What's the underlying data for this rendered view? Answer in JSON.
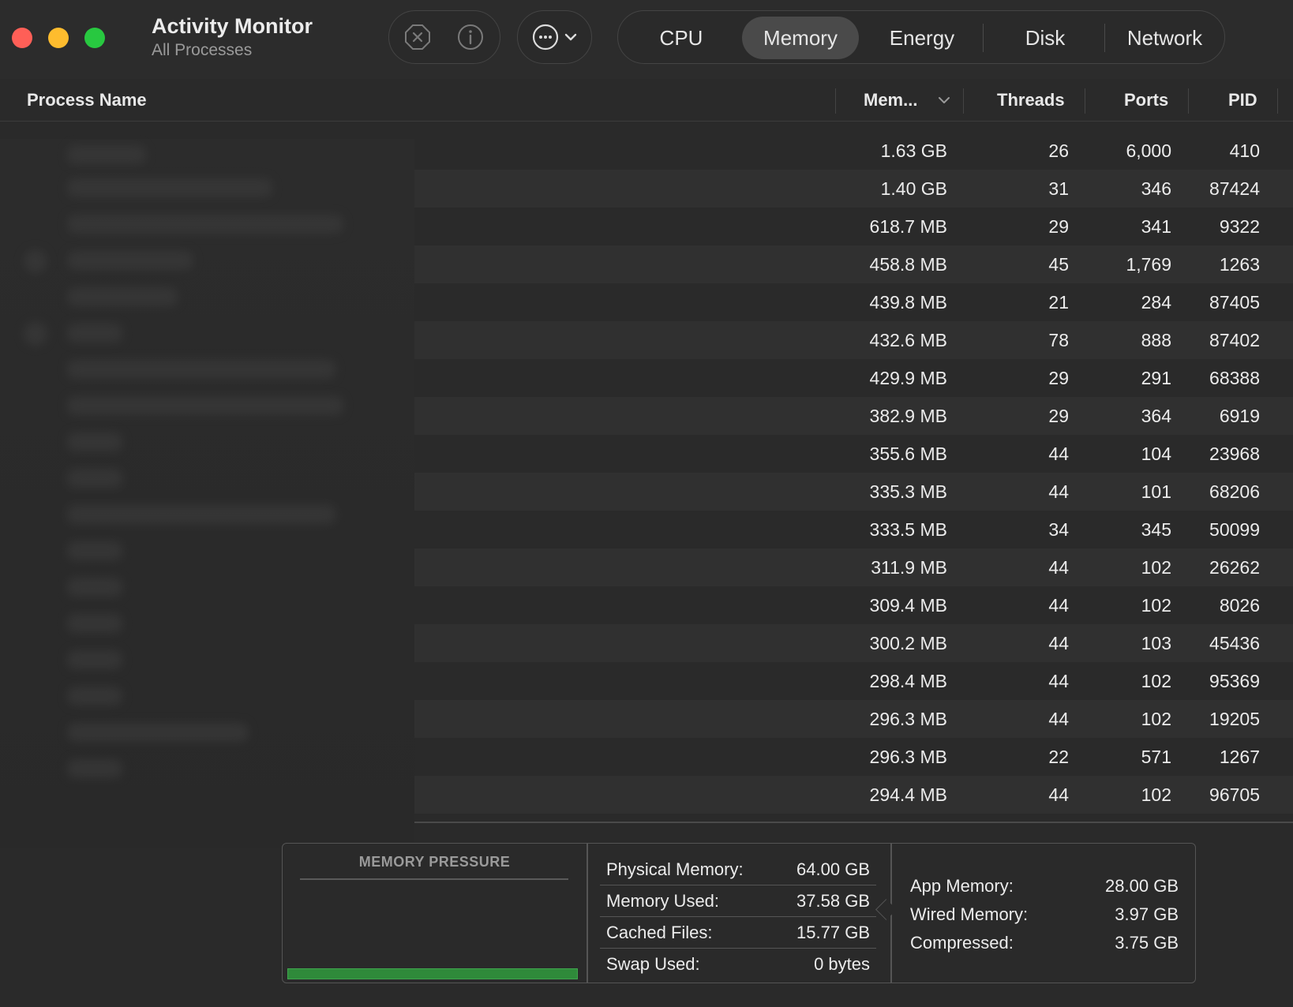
{
  "app": {
    "title": "Activity Monitor",
    "subtitle": "All Processes"
  },
  "toolbar": {
    "stop_icon": "stop-process-icon",
    "info_icon": "info-icon",
    "more_icon": "more-options-icon",
    "tabs": [
      "CPU",
      "Memory",
      "Energy",
      "Disk",
      "Network"
    ],
    "active_tab": "Memory"
  },
  "columns": {
    "name": "Process Name",
    "memory": "Mem...",
    "threads": "Threads",
    "ports": "Ports",
    "pid": "PID"
  },
  "rows": [
    {
      "memory": "1.63 GB",
      "threads": "26",
      "ports": "6,000",
      "pid": "410"
    },
    {
      "memory": "1.40 GB",
      "threads": "31",
      "ports": "346",
      "pid": "87424"
    },
    {
      "memory": "618.7 MB",
      "threads": "29",
      "ports": "341",
      "pid": "9322"
    },
    {
      "memory": "458.8 MB",
      "threads": "45",
      "ports": "1,769",
      "pid": "1263"
    },
    {
      "memory": "439.8 MB",
      "threads": "21",
      "ports": "284",
      "pid": "87405"
    },
    {
      "memory": "432.6 MB",
      "threads": "78",
      "ports": "888",
      "pid": "87402"
    },
    {
      "memory": "429.9 MB",
      "threads": "29",
      "ports": "291",
      "pid": "68388"
    },
    {
      "memory": "382.9 MB",
      "threads": "29",
      "ports": "364",
      "pid": "6919"
    },
    {
      "memory": "355.6 MB",
      "threads": "44",
      "ports": "104",
      "pid": "23968"
    },
    {
      "memory": "335.3 MB",
      "threads": "44",
      "ports": "101",
      "pid": "68206"
    },
    {
      "memory": "333.5 MB",
      "threads": "34",
      "ports": "345",
      "pid": "50099"
    },
    {
      "memory": "311.9 MB",
      "threads": "44",
      "ports": "102",
      "pid": "26262"
    },
    {
      "memory": "309.4 MB",
      "threads": "44",
      "ports": "102",
      "pid": "8026"
    },
    {
      "memory": "300.2 MB",
      "threads": "44",
      "ports": "103",
      "pid": "45436"
    },
    {
      "memory": "298.4 MB",
      "threads": "44",
      "ports": "102",
      "pid": "95369"
    },
    {
      "memory": "296.3 MB",
      "threads": "44",
      "ports": "102",
      "pid": "19205"
    },
    {
      "memory": "296.3 MB",
      "threads": "22",
      "ports": "571",
      "pid": "1267"
    },
    {
      "memory": "294.4 MB",
      "threads": "44",
      "ports": "102",
      "pid": "96705"
    }
  ],
  "memory_pressure": {
    "title": "MEMORY PRESSURE",
    "level": 1.0,
    "color": "#2f8a3a"
  },
  "stats": {
    "physical_memory": {
      "label": "Physical Memory:",
      "value": "64.00 GB"
    },
    "memory_used": {
      "label": "Memory Used:",
      "value": "37.58 GB"
    },
    "cached_files": {
      "label": "Cached Files:",
      "value": "15.77 GB"
    },
    "swap_used": {
      "label": "Swap Used:",
      "value": "0 bytes"
    },
    "app_memory": {
      "label": "App Memory:",
      "value": "28.00 GB"
    },
    "wired_memory": {
      "label": "Wired Memory:",
      "value": "3.97 GB"
    },
    "compressed": {
      "label": "Compressed:",
      "value": "3.75 GB"
    }
  }
}
